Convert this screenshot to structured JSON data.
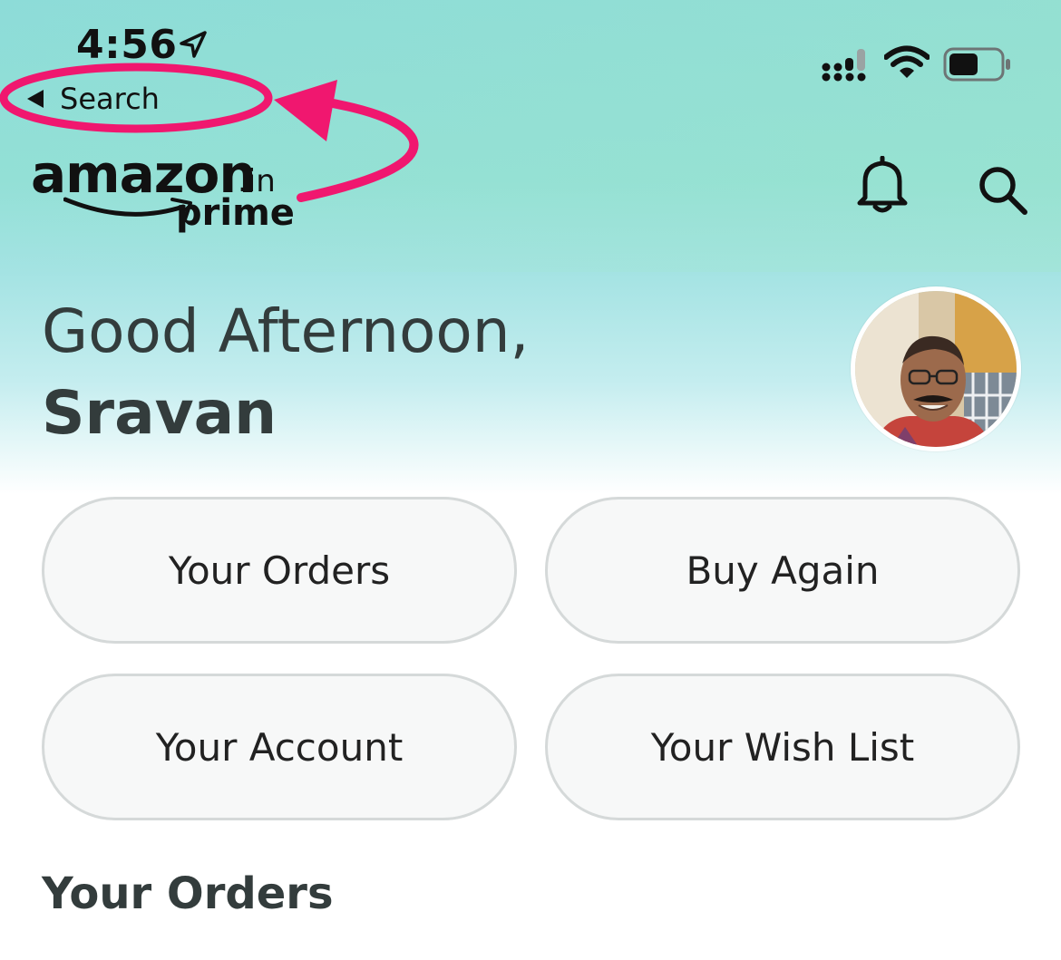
{
  "status_bar": {
    "time": "4:56",
    "back_label": "Search"
  },
  "header": {
    "logo_word": "amazon",
    "logo_domain": ".in",
    "logo_sub": "prime"
  },
  "greeting": {
    "salutation": "Good Afternoon,",
    "name": "Sravan"
  },
  "quick_links": [
    {
      "label": "Your Orders"
    },
    {
      "label": "Buy Again"
    },
    {
      "label": "Your Account"
    },
    {
      "label": "Your Wish List"
    }
  ],
  "sections": {
    "orders_title": "Your Orders"
  },
  "colors": {
    "annotation": "#f0176f",
    "text_dark": "#333c3c",
    "pill_border": "#d5d9d9",
    "gradient_top": "#8ddcd8"
  },
  "icons": [
    "location-arrow-icon",
    "signal-icon",
    "wifi-icon",
    "battery-icon",
    "back-triangle-icon",
    "bell-icon",
    "search-icon"
  ]
}
